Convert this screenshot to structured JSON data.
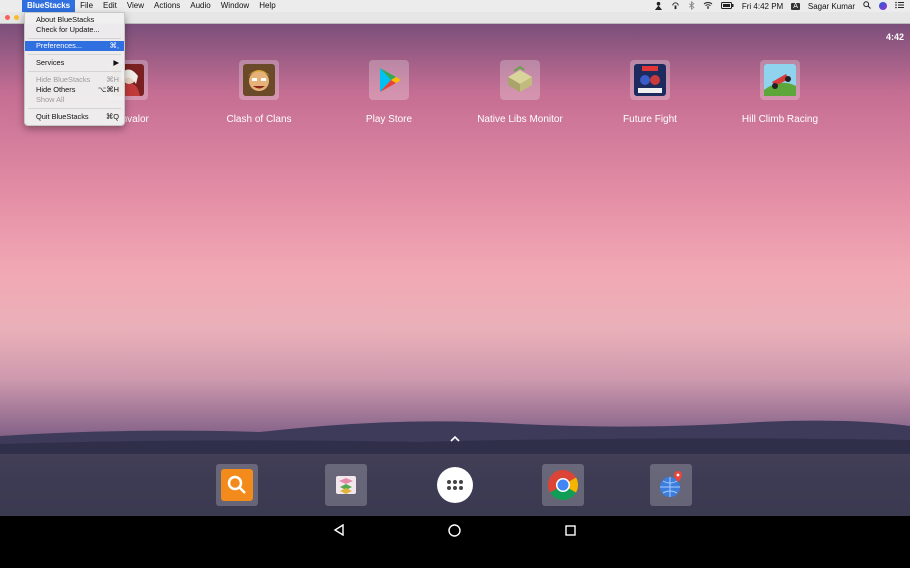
{
  "menubar": {
    "app_menu": "BlueStacks",
    "items": [
      "File",
      "Edit",
      "View",
      "Actions",
      "Audio",
      "Window",
      "Help"
    ],
    "clock": "Fri 4:42 PM",
    "user": "Sagar Kumar",
    "input_badge": "A"
  },
  "app_menu": {
    "items": [
      {
        "label": "About BlueStacks",
        "shortcut": ""
      },
      {
        "label": "Check for Update...",
        "shortcut": ""
      },
      {
        "label": "Preferences...",
        "shortcut": "⌘,"
      },
      {
        "label": "Services",
        "shortcut": "▶"
      },
      {
        "label": "Hide BlueStacks",
        "shortcut": "⌘H"
      },
      {
        "label": "Hide Others",
        "shortcut": "⌥⌘H"
      },
      {
        "label": "Show All",
        "shortcut": ""
      },
      {
        "label": "Quit BlueStacks",
        "shortcut": "⌘Q"
      }
    ]
  },
  "android": {
    "status_time": "4:42",
    "apps": [
      {
        "label": "Shinvalor",
        "color": "#b23a3a"
      },
      {
        "label": "Clash of Clans",
        "color": "#c98a2a"
      },
      {
        "label": "Play Store",
        "color": "#34a853"
      },
      {
        "label": "Native Libs Monitor",
        "color": "#b9c27a"
      },
      {
        "label": "Future Fight",
        "color": "#2b3f8c"
      },
      {
        "label": "Hill Climb Racing",
        "color": "#5da63a"
      }
    ],
    "dock": [
      "search-app",
      "gallery-app",
      "app-drawer",
      "chrome",
      "maps-app"
    ]
  },
  "colors": {
    "accent": "#2f6fe0",
    "search_orange": "#f28a1c"
  }
}
